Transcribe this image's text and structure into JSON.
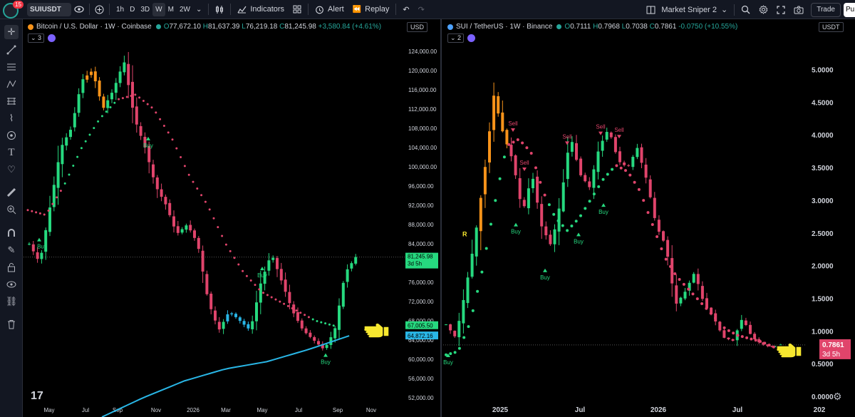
{
  "topbar": {
    "notif_count": "15",
    "symbol": "SUIUSDT",
    "timeframes": [
      "1h",
      "D",
      "3D",
      "W",
      "M",
      "2W"
    ],
    "active_timeframe": "W",
    "indicators_label": "Indicators",
    "alert_label": "Alert",
    "replay_label": "Replay",
    "layout_name": "Market Sniper 2",
    "trade_label": "Trade",
    "publish_label": "Pu"
  },
  "left_chart": {
    "title": "Bitcoin / U.S. Dollar · 1W · Coinbase",
    "ohlc": {
      "o": "77,672.10",
      "h": "81,637.39",
      "l": "76,219.18",
      "c": "81,245.98",
      "chg": "+3,580.84 (+4.61%)"
    },
    "indicator_count": "3",
    "currency": "USD",
    "price_ticks": [
      "124,000.00",
      "120,000.00",
      "116,000.00",
      "112,000.00",
      "108,000.00",
      "104,000.00",
      "100,000.00",
      "96,000.00",
      "92,000.00",
      "88,000.00",
      "84,000.00",
      "80,000.00",
      "76,000.00",
      "72,000.00",
      "68,000.00",
      "64,000.00",
      "60,000.00",
      "56,000.00",
      "52,000.00"
    ],
    "last_price_label": "81,245.98",
    "countdown": "3d 5h",
    "ma_label_1": "67,005.50",
    "ma_label_2": "64,872.16",
    "time_ticks": [
      "May",
      "Jul",
      "Sep",
      "Nov",
      "2026",
      "Mar",
      "May",
      "Jul",
      "Sep",
      "Nov"
    ],
    "signals": [
      "Buy",
      "Buy",
      "Buy",
      "Buy"
    ],
    "colors": {
      "up": "#26d97f",
      "down": "#e0446b",
      "orange": "#f7931a",
      "ma": "#29b6e6"
    }
  },
  "right_chart": {
    "title": "SUI / TetherUS · 1W · Binance",
    "ohlc": {
      "o": "0.7111",
      "h": "0.7968",
      "l": "0.7038",
      "c": "0.7861",
      "chg": "-0.0750 (+10.55%)"
    },
    "indicator_count": "2",
    "currency": "USDT",
    "price_ticks": [
      "5.0000",
      "4.5000",
      "4.0000",
      "3.5000",
      "3.0000",
      "2.5000",
      "2.0000",
      "1.5000",
      "1.0000",
      "0.5000",
      "0.0000"
    ],
    "last_price_label": "0.7861",
    "countdown": "3d 5h",
    "time_ticks": [
      "2025",
      "Jul",
      "2026",
      "Jul",
      "202"
    ],
    "buy_signals": [
      "Buy",
      "Buy",
      "Buy",
      "Buy",
      "Buy"
    ],
    "sell_signals": [
      "Sell",
      "Sell",
      "Sell",
      "Sell",
      "Sell"
    ],
    "marker_r": "R"
  }
}
